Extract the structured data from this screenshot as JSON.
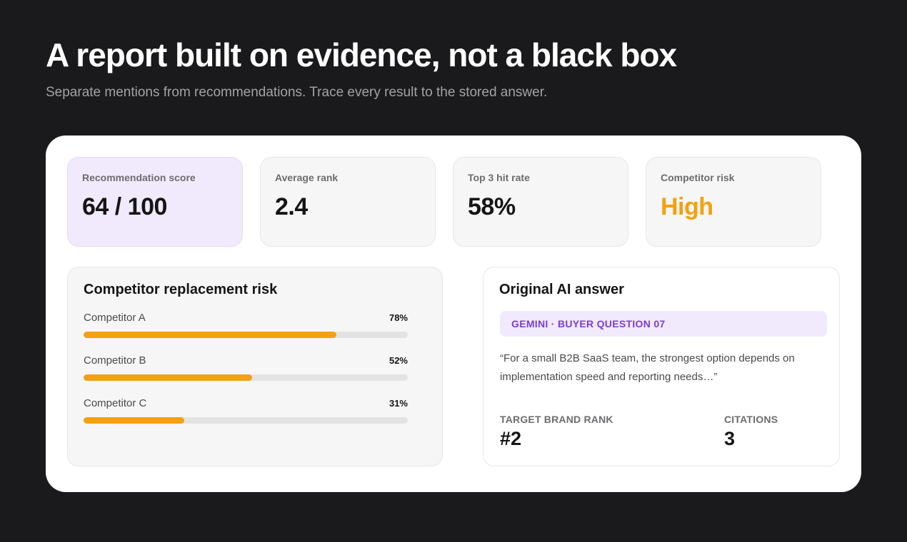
{
  "header": {
    "title": "A report built on evidence, not a black box",
    "subtitle": "Separate mentions from recommendations. Trace every result to the stored answer."
  },
  "metrics": [
    {
      "label": "Recommendation score",
      "value": "64 / 100"
    },
    {
      "label": "Average rank",
      "value": "2.4"
    },
    {
      "label": "Top 3 hit rate",
      "value": "58%"
    },
    {
      "label": "Competitor risk",
      "value": "High"
    }
  ],
  "risk_panel": {
    "title": "Competitor replacement risk",
    "items": [
      {
        "name": "Competitor A",
        "percent_label": "78%",
        "percent": 78
      },
      {
        "name": "Competitor B",
        "percent_label": "52%",
        "percent": 52
      },
      {
        "name": "Competitor C",
        "percent_label": "31%",
        "percent": 31
      }
    ]
  },
  "answer_panel": {
    "title": "Original AI answer",
    "source_tag": "GEMINI · BUYER QUESTION 07",
    "quote": "“For a small B2B SaaS team, the strongest option depends on implementation speed and reporting needs…”",
    "stats": [
      {
        "label": "TARGET BRAND RANK",
        "value": "#2"
      },
      {
        "label": "CITATIONS",
        "value": "3"
      }
    ]
  },
  "colors": {
    "background": "#1a1a1c",
    "accent_purple": "#7a3fd1",
    "accent_purple_bg": "#f1e9fc",
    "warning_orange": "#f5a00f"
  }
}
